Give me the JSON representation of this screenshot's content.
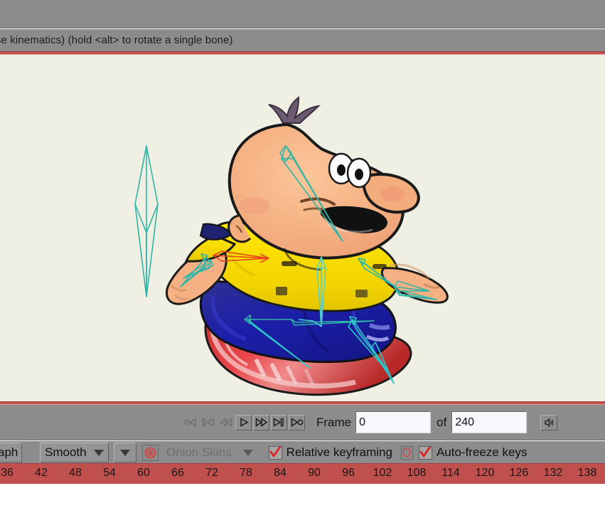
{
  "window": {
    "hint_text": "se kinematics) (hold <alt> to rotate a single bone)",
    "canvas_bg": "#f0efe3",
    "chrome_bg": "#8c8c8c",
    "accent_red": "#c0504d"
  },
  "playback": {
    "buttons": [
      {
        "name": "go-to-start-button",
        "glyph": "loop-start",
        "enabled": false
      },
      {
        "name": "previous-keyframe-button",
        "glyph": "prev-key",
        "enabled": false
      },
      {
        "name": "step-back-button",
        "glyph": "rewind",
        "enabled": false
      },
      {
        "name": "play-button",
        "glyph": "play",
        "enabled": true
      },
      {
        "name": "fast-forward-button",
        "glyph": "fast-forward",
        "enabled": true
      },
      {
        "name": "next-keyframe-button",
        "glyph": "next-key",
        "enabled": true
      },
      {
        "name": "play-loop-button",
        "glyph": "play-loop",
        "enabled": true
      }
    ],
    "frame_label": "Frame",
    "frame_value": "0",
    "of_label": "of",
    "total_frames_value": "240",
    "sound_button_icon": "speaker-icon"
  },
  "options": {
    "graph_button_label": "aph",
    "interpolation_value": "Smooth",
    "secondary_dropdown_value": "",
    "onion_icon": "onion-skin-icon",
    "onion_skins_label": "Onion Skins",
    "onion_skins_enabled": false,
    "relative_keyframing_label": "Relative keyframing",
    "relative_keyframing_checked": true,
    "shield_icon": "shield-icon",
    "auto_freeze_label": "Auto-freeze keys",
    "auto_freeze_checked": true
  },
  "timeline": {
    "ticks": [
      36,
      42,
      48,
      54,
      60,
      66,
      72,
      78,
      84,
      90,
      96,
      102,
      108,
      114,
      120,
      126,
      132,
      138
    ],
    "tick_positions": [
      10,
      58,
      106,
      154,
      202,
      250,
      298,
      346,
      394,
      442,
      490,
      538,
      586,
      634,
      682,
      730,
      778,
      826
    ],
    "background": "#c0504d"
  },
  "artwork": {
    "description": "cartoon skateboarder character with bone rig overlay",
    "bone_color": "#2fb6a8",
    "bone_color_selected": "#e8431f",
    "bone_color_light": "#29c7c7"
  }
}
